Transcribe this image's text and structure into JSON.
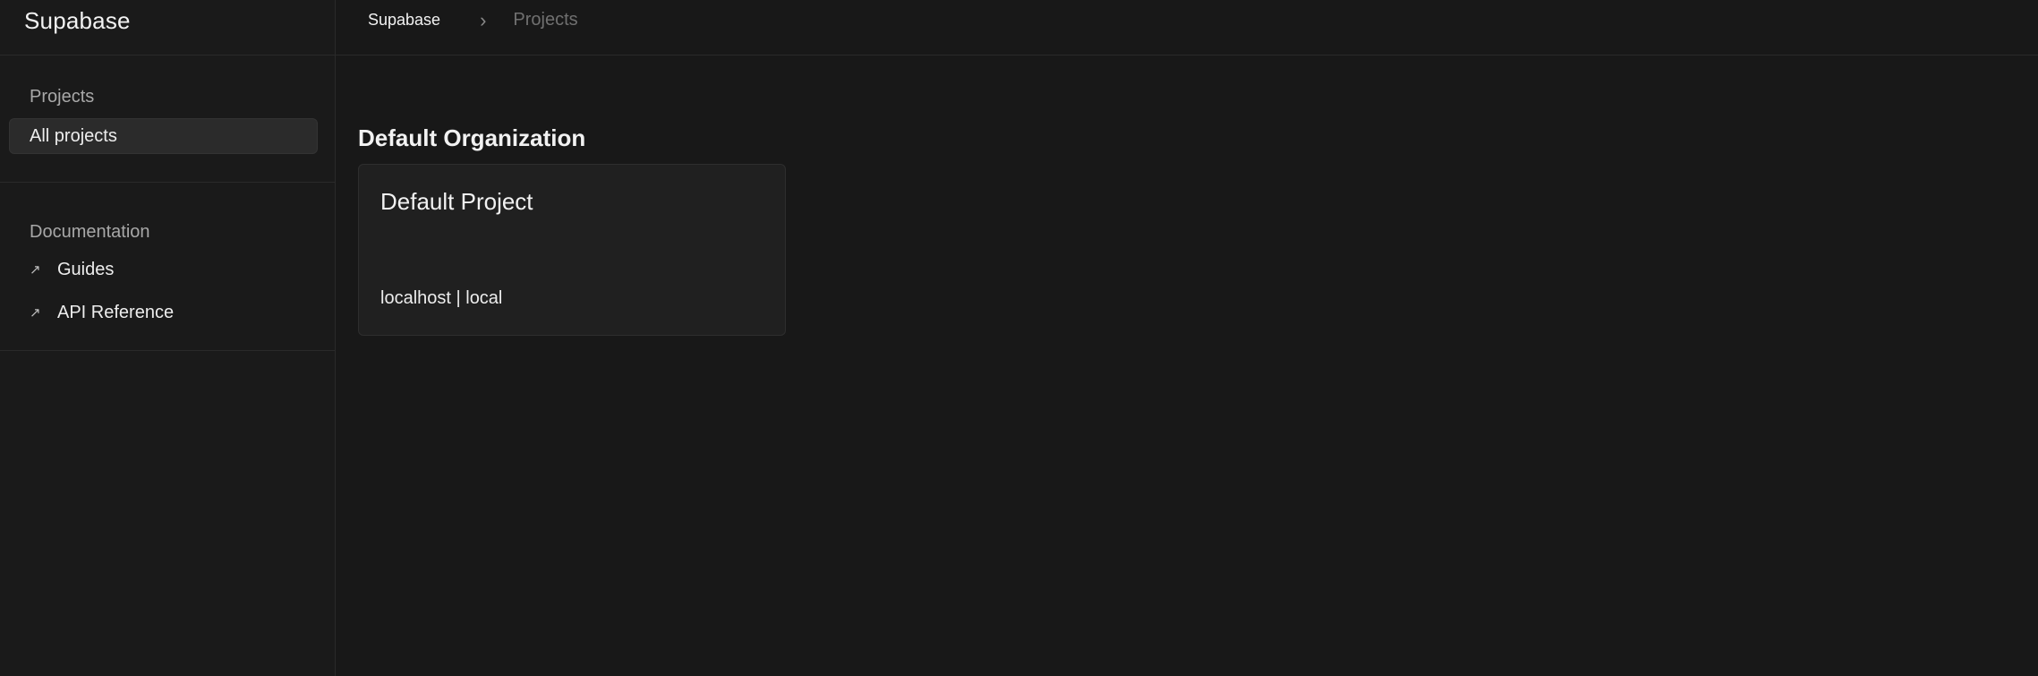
{
  "brand": {
    "name": "Supabase"
  },
  "breadcrumb": {
    "root": "Supabase",
    "separator": "›",
    "current": "Projects"
  },
  "sidebar": {
    "projects_heading": "Projects",
    "projects_items": [
      {
        "label": "All projects",
        "active": true
      }
    ],
    "docs_heading": "Documentation",
    "docs_items": [
      {
        "label": "Guides",
        "icon": "external-arrow-icon"
      },
      {
        "label": "API Reference",
        "icon": "external-arrow-icon"
      }
    ]
  },
  "main": {
    "organization": "Default Organization",
    "projects": [
      {
        "name": "Default Project",
        "meta": "localhost | local"
      }
    ]
  },
  "icons": {
    "external": "↗",
    "chevron": "›"
  },
  "colors": {
    "background": "#181818",
    "card": "#202020",
    "border": "#2a2a2a",
    "text": "#ededed",
    "muted": "#707070"
  }
}
